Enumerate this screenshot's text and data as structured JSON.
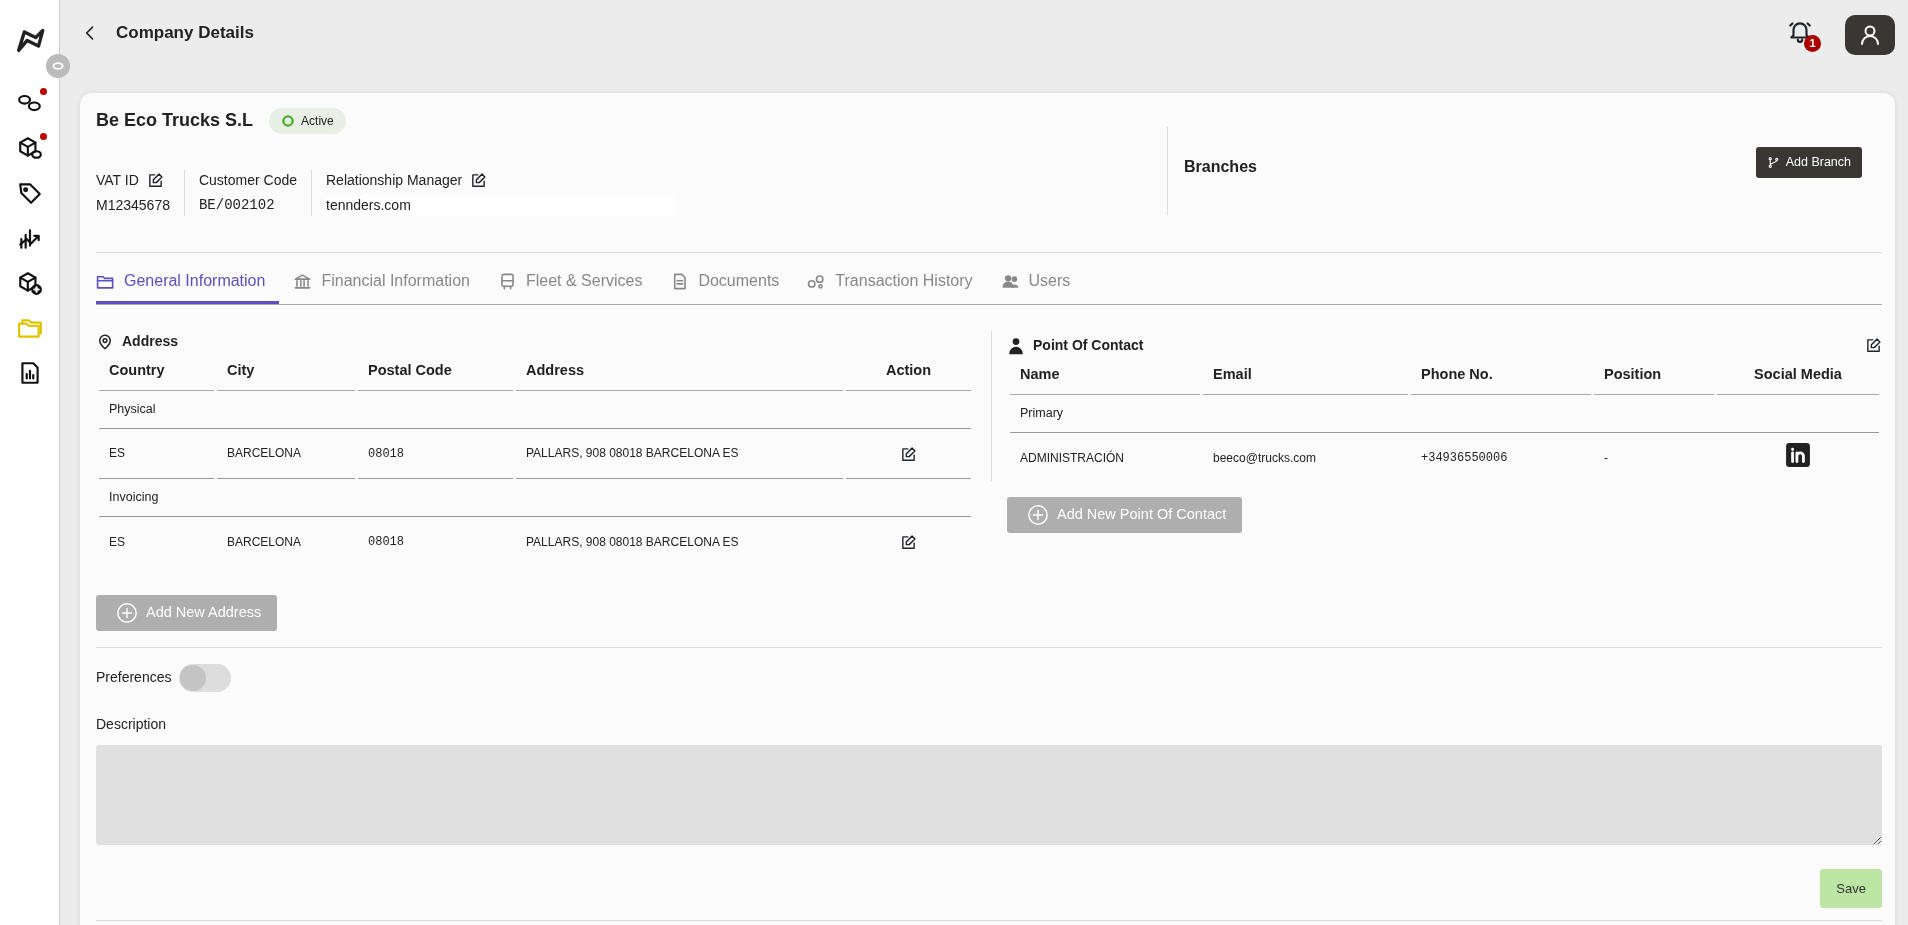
{
  "sidebar": {
    "items": [
      {
        "selected": false,
        "dot": true
      },
      {
        "selected": false,
        "dot": true
      },
      {
        "selected": false,
        "dot": false
      },
      {
        "selected": false,
        "dot": false
      },
      {
        "selected": false,
        "dot": false
      },
      {
        "selected": true,
        "dot": false
      },
      {
        "selected": false,
        "dot": false
      }
    ]
  },
  "header": {
    "title": "Company Details",
    "notifications": "1"
  },
  "company": {
    "name": "Be Eco Trucks S.L",
    "status": "Active",
    "fields": [
      {
        "label": "VAT ID",
        "value": "M12345678",
        "editable": true
      },
      {
        "label": "Customer Code",
        "value": "BE/002102",
        "editable": false
      },
      {
        "label": "Relationship Manager",
        "value": "tennders.com",
        "editable": true
      }
    ]
  },
  "branches": {
    "title": "Branches",
    "button": "Add Branch"
  },
  "tabs": [
    {
      "label": "General Information",
      "selected": true
    },
    {
      "label": "Financial Information",
      "selected": false
    },
    {
      "label": "Fleet & Services",
      "selected": false
    },
    {
      "label": "Documents",
      "selected": false
    },
    {
      "label": "Transaction History",
      "selected": false
    },
    {
      "label": "Users",
      "selected": false
    }
  ],
  "address": {
    "title": "Address",
    "columns": [
      "Country",
      "City",
      "Postal Code",
      "Address",
      "Action"
    ],
    "groups": [
      {
        "label": "Physical",
        "rows": [
          {
            "cells": [
              "ES",
              "BARCELONA",
              "08018",
              "PALLARS, 908 08018 BARCELONA ES"
            ]
          }
        ]
      },
      {
        "label": "Invoicing",
        "rows": [
          {
            "cells": [
              "ES",
              "BARCELONA",
              "08018",
              "PALLARS, 908 08018 BARCELONA ES"
            ]
          }
        ]
      }
    ],
    "button": {
      "label": "Add New Address",
      "disabled": true
    }
  },
  "contact": {
    "title": "Point Of Contact",
    "columns": [
      "Name",
      "Email",
      "Phone No.",
      "Position",
      "Social Media"
    ],
    "groups": [
      {
        "label": "Primary",
        "rows": [
          {
            "cells": [
              "ADMINISTRACIÓN",
              "beeco@trucks.com",
              "+34936550006",
              "-"
            ],
            "linkedin": true
          }
        ]
      }
    ],
    "button": {
      "label": "Add New Point Of Contact",
      "disabled": true
    }
  },
  "preferences": {
    "label": "Preferences",
    "on": false
  },
  "description": {
    "label": "Description"
  },
  "save": {
    "label": "Save",
    "disabled": true
  }
}
